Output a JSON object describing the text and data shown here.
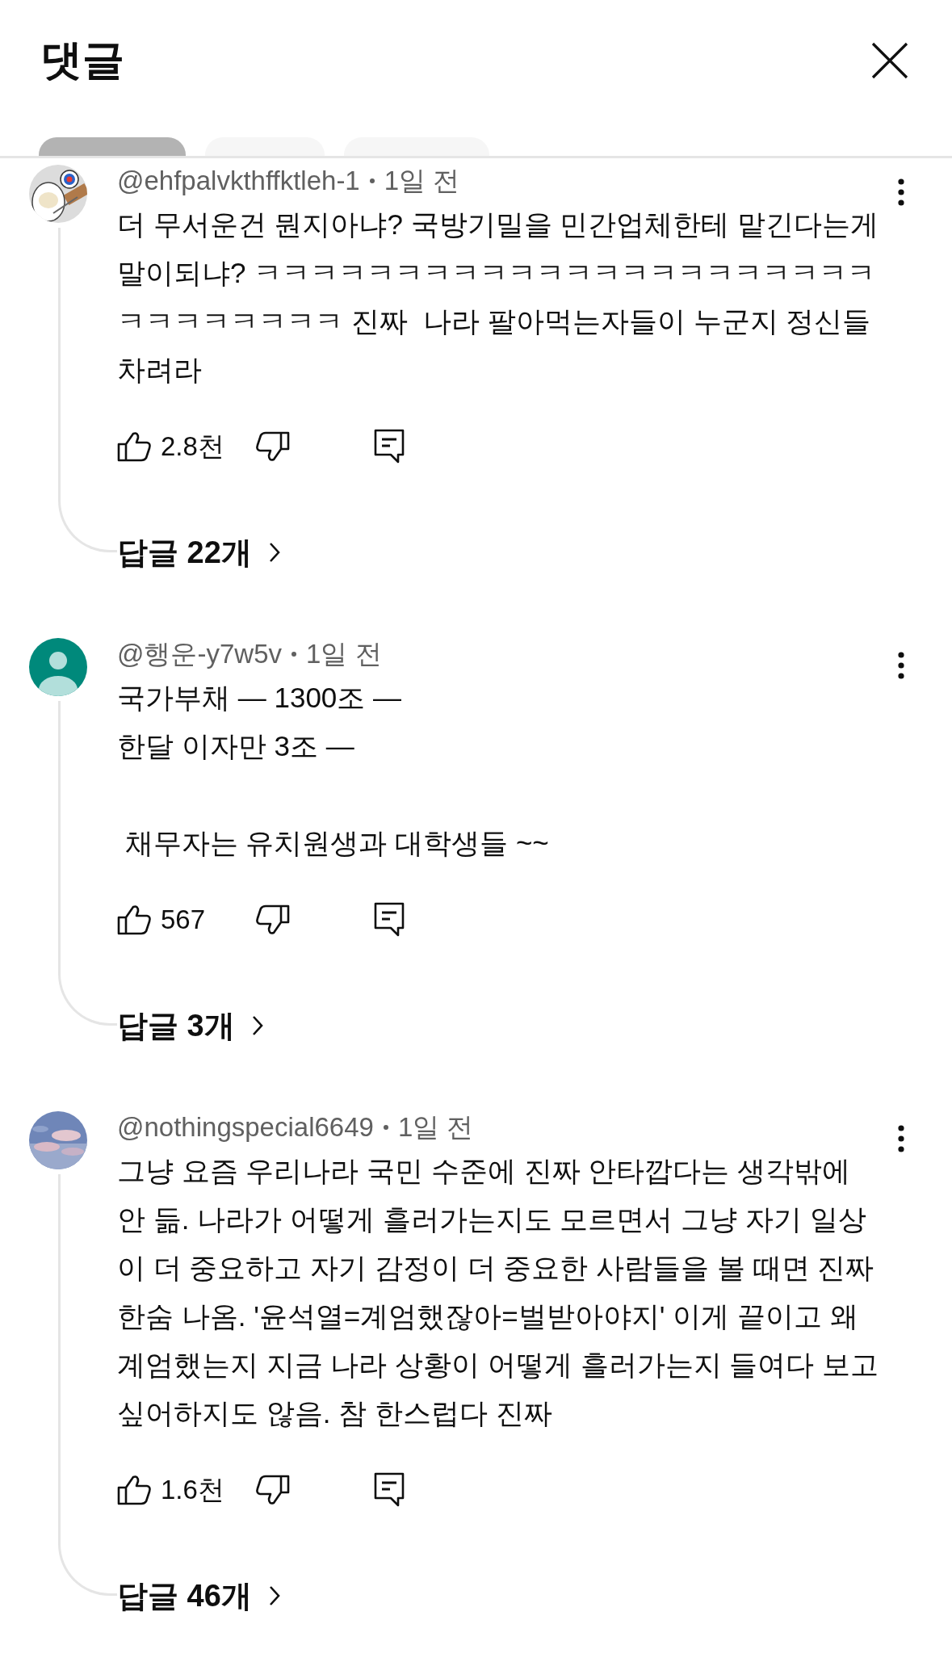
{
  "header": {
    "title": "댓글"
  },
  "chips": [
    {
      "selected": true
    },
    {
      "selected": false
    },
    {
      "selected": false
    }
  ],
  "comments": [
    {
      "avatar": {
        "kind": "cartoon"
      },
      "author": "@ehfpalvkthffktleh-1",
      "time": "1일 전",
      "text": "더 무서운건 뭔지아냐? 국방기밀을 민간업체한테 맡긴다는게 말이되냐? ㅋㅋㅋㅋㅋㅋㅋㅋㅋㅋㅋㅋㅋㅋㅋㅋㅋㅋㅋㅋㅋㅋㅋㅋㅋㅋㅋㅋㅋㅋ 진짜  나라 팔아먹는자들이 누군지 정신들 차려라",
      "likes": "2.8천",
      "replies": "답글 22개"
    },
    {
      "avatar": {
        "kind": "default"
      },
      "author": "@행운-y7w5v",
      "time": "1일 전",
      "text": "국가부채 — 1300조 —\n한달 이자만 3조 —\n\n 채무자는 유치원생과 대학생들 ~~",
      "likes": "567",
      "replies": "답글 3개"
    },
    {
      "avatar": {
        "kind": "sky"
      },
      "author": "@nothingspecial6649",
      "time": "1일 전",
      "text": "그냥 요즘 우리나라 국민 수준에 진짜 안타깝다는 생각밖에 안 듦. 나라가 어떻게 흘러가는지도 모르면서 그냥 자기 일상이 더 중요하고 자기 감정이 더 중요한 사람들을 볼 때면 진짜 한숨 나옴. '윤석열=계엄했잖아=벌받아야지' 이게 끝이고 왜 계엄했는지 지금 나라 상황이 어떻게 흘러가는지 들여다 보고 싶어하지도 않음. 참 한스럽다 진짜",
      "likes": "1.6천",
      "replies": "답글 46개"
    }
  ]
}
